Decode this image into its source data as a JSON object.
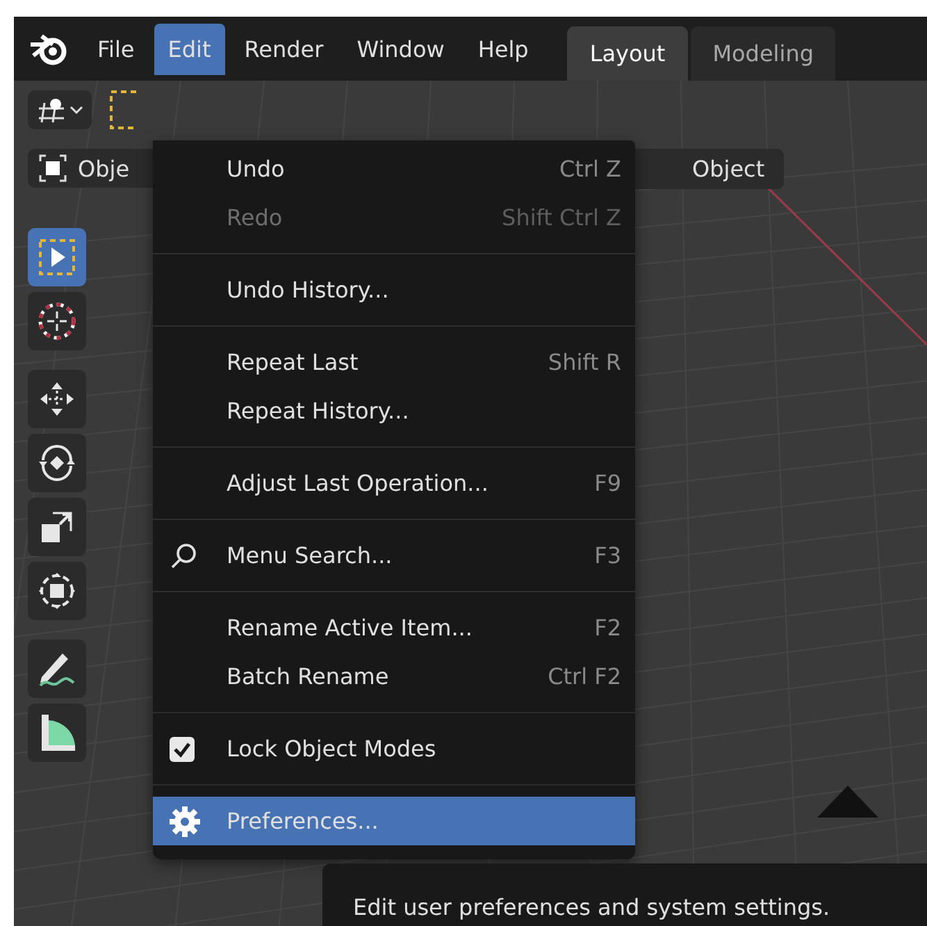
{
  "menubar": [
    {
      "label": "File",
      "selected": false
    },
    {
      "label": "Edit",
      "selected": true
    },
    {
      "label": "Render",
      "selected": false
    },
    {
      "label": "Window",
      "selected": false
    },
    {
      "label": "Help",
      "selected": false
    }
  ],
  "workspace_tabs": [
    {
      "label": "Layout",
      "selected": true
    },
    {
      "label": "Modeling",
      "selected": false
    }
  ],
  "viewport_header": {
    "mode_button": "Obje",
    "object_menu": "Object"
  },
  "tools": [
    {
      "kind": "select",
      "selected": true
    },
    {
      "kind": "cursor",
      "selected": false
    },
    {
      "kind": "move",
      "selected": false
    },
    {
      "kind": "rotate",
      "selected": false
    },
    {
      "kind": "scale",
      "selected": false
    },
    {
      "kind": "transform",
      "selected": false
    },
    {
      "kind": "annotate",
      "selected": false
    },
    {
      "kind": "measure",
      "selected": false
    }
  ],
  "edit_menu": [
    {
      "kind": "command",
      "label": "Undo",
      "shortcut": "Ctrl Z",
      "disabled": false,
      "selected": false
    },
    {
      "kind": "command",
      "label": "Redo",
      "shortcut": "Shift Ctrl Z",
      "disabled": true,
      "selected": false
    },
    {
      "kind": "separator"
    },
    {
      "kind": "command",
      "label": "Undo History...",
      "disabled": false,
      "selected": false
    },
    {
      "kind": "separator"
    },
    {
      "kind": "command",
      "label": "Repeat Last",
      "shortcut": "Shift R",
      "disabled": false,
      "selected": false
    },
    {
      "kind": "command",
      "label": "Repeat History...",
      "disabled": false,
      "selected": false
    },
    {
      "kind": "separator"
    },
    {
      "kind": "command",
      "label": "Adjust Last Operation...",
      "shortcut": "F9",
      "disabled": false,
      "selected": false
    },
    {
      "kind": "separator"
    },
    {
      "kind": "search",
      "label": "Menu Search...",
      "shortcut": "F3",
      "disabled": false,
      "selected": false
    },
    {
      "kind": "separator"
    },
    {
      "kind": "command",
      "label": "Rename Active Item...",
      "shortcut": "F2",
      "disabled": false,
      "selected": false
    },
    {
      "kind": "command",
      "label": "Batch Rename",
      "shortcut": "Ctrl F2",
      "disabled": false,
      "selected": false
    },
    {
      "kind": "separator"
    },
    {
      "kind": "checkbox",
      "label": "Lock Object Modes",
      "checked": true,
      "disabled": false,
      "selected": false
    },
    {
      "kind": "separator"
    },
    {
      "kind": "settings",
      "label": "Preferences...",
      "disabled": false,
      "selected": true
    }
  ],
  "tooltip": {
    "text": "Edit user preferences and system settings."
  }
}
